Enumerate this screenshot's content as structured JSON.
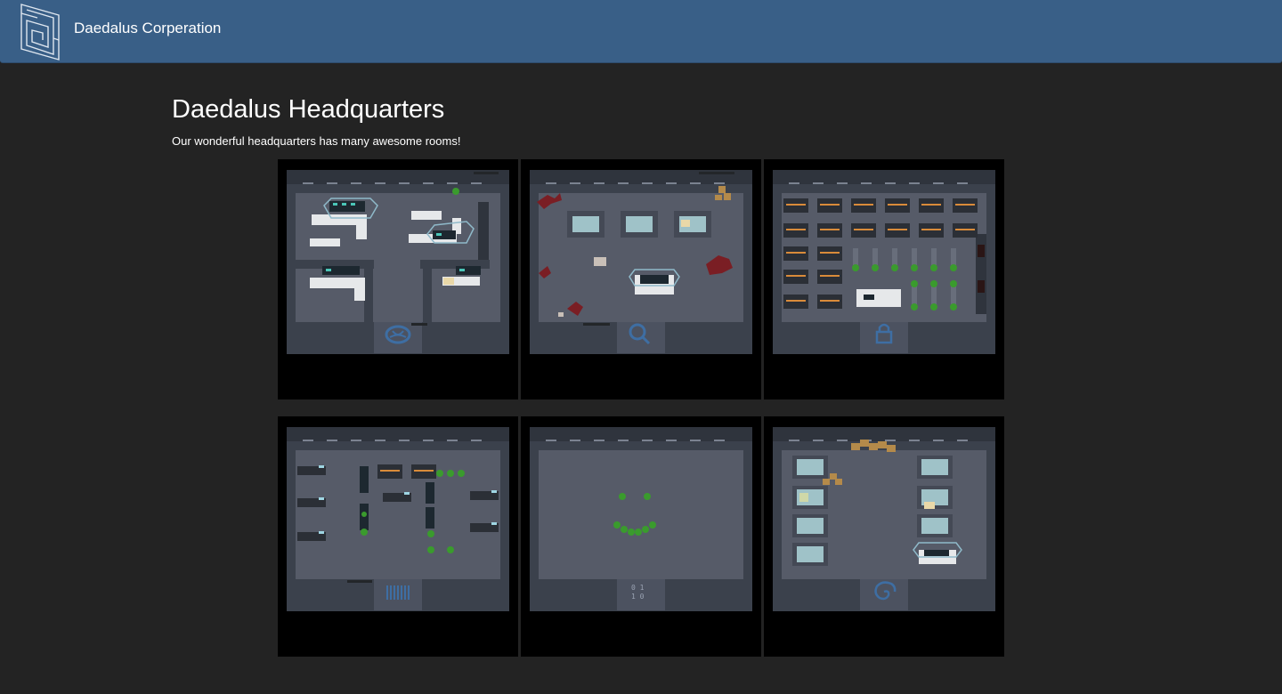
{
  "header": {
    "brand": "Daedalus Corperation",
    "logo_icon": "maze-logo-icon",
    "background": "#395f87"
  },
  "main": {
    "title": "Daedalus Headquarters",
    "subtitle": "Our wonderful headquarters has many awesome rooms!"
  },
  "rooms": [
    {
      "room_icon": "brain-icon",
      "content": "office-desks"
    },
    {
      "room_icon": "magnifier-icon",
      "content": "investigation-lab"
    },
    {
      "room_icon": "padlock-icon",
      "content": "server-room"
    },
    {
      "room_icon": "barcode-icon",
      "content": "open-office"
    },
    {
      "room_icon": "binary-icon",
      "content": "smiley-plants"
    },
    {
      "room_icon": "spiral-icon",
      "content": "storage-bay"
    }
  ],
  "colors": {
    "page_background": "#232323",
    "room_floor": "#565b68",
    "room_wall": "#3b414c",
    "icon_blue": "#3e6ea3",
    "plant_green": "#3a9b2d"
  }
}
